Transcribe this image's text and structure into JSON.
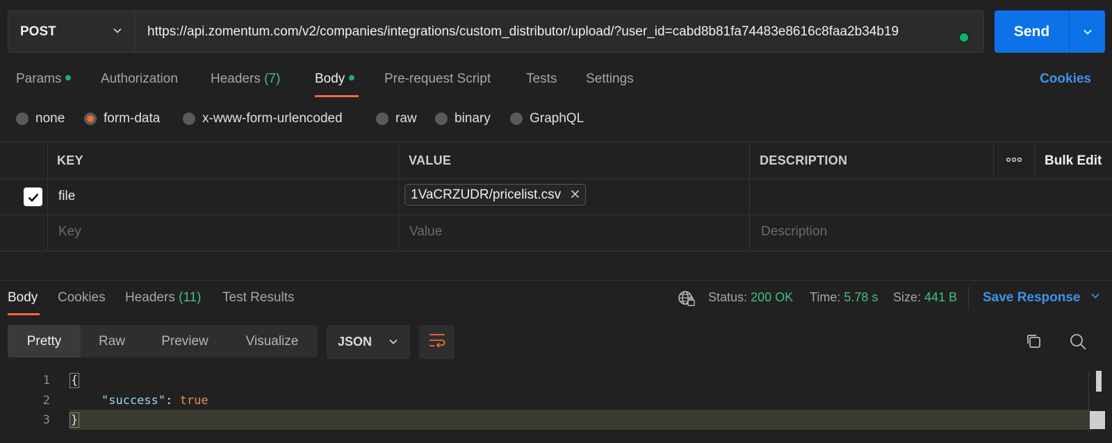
{
  "request": {
    "method": "POST",
    "url": "https://api.zomentum.com/v2/companies/integrations/custom_distributor/upload/?user_id=cabd8b81fa74483e8616c8faa2b34b19",
    "send_label": "Send"
  },
  "tabs": [
    {
      "label": "Params"
    },
    {
      "label": "Authorization"
    },
    {
      "label": "Headers",
      "count": "(7)"
    },
    {
      "label": "Body"
    },
    {
      "label": "Pre-request Script"
    },
    {
      "label": "Tests"
    },
    {
      "label": "Settings"
    }
  ],
  "cookies_link": "Cookies",
  "body_types": [
    "none",
    "form-data",
    "x-www-form-urlencoded",
    "raw",
    "binary",
    "GraphQL"
  ],
  "table": {
    "headers": {
      "key": "KEY",
      "value": "VALUE",
      "description": "DESCRIPTION",
      "bulk_edit": "Bulk Edit"
    },
    "rows": [
      {
        "key": "file",
        "value": "1VaCRZUDR/pricelist.csv",
        "checked": true
      }
    ],
    "placeholders": {
      "key": "Key",
      "value": "Value",
      "description": "Description"
    }
  },
  "response": {
    "tabs": [
      {
        "label": "Body"
      },
      {
        "label": "Cookies"
      },
      {
        "label": "Headers",
        "count": "(11)"
      },
      {
        "label": "Test Results"
      }
    ],
    "status_label": "Status:",
    "status_value": "200 OK",
    "time_label": "Time:",
    "time_value": "5.78 s",
    "size_label": "Size:",
    "size_value": "441 B",
    "save_label": "Save Response",
    "views": [
      "Pretty",
      "Raw",
      "Preview",
      "Visualize"
    ],
    "format": "JSON",
    "code": {
      "line_numbers": [
        "1",
        "2",
        "3"
      ],
      "open_brace": "{",
      "key": "\"success\"",
      "colon": ": ",
      "value": "true",
      "close_brace": "}"
    }
  },
  "colors": {
    "accent": "#0d72e8",
    "tab_underline": "#f26b3a",
    "success": "#3ec27d",
    "link": "#3e93ea"
  }
}
